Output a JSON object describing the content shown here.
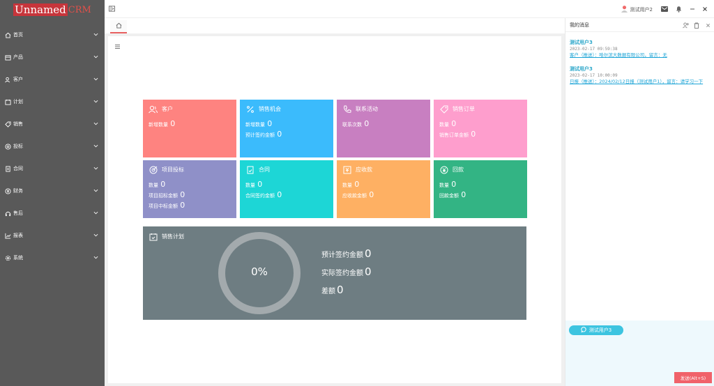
{
  "logo": {
    "part1": "Unnamed",
    "part2": "CRM"
  },
  "sidebar": {
    "items": [
      {
        "label": "首页",
        "icon": "home-icon"
      },
      {
        "label": "产品",
        "icon": "box-icon"
      },
      {
        "label": "客户",
        "icon": "users-icon"
      },
      {
        "label": "计划",
        "icon": "calendar-icon"
      },
      {
        "label": "销售",
        "icon": "tag-icon"
      },
      {
        "label": "投标",
        "icon": "target-icon"
      },
      {
        "label": "合同",
        "icon": "document-icon"
      },
      {
        "label": "财务",
        "icon": "yen-icon"
      },
      {
        "label": "售后",
        "icon": "headset-icon"
      },
      {
        "label": "报表",
        "icon": "chart-icon"
      },
      {
        "label": "系统",
        "icon": "gear-icon"
      }
    ]
  },
  "topbar": {
    "username": "测试用户2"
  },
  "cards": [
    {
      "title": "客户",
      "color": "#fe8380",
      "lines": [
        {
          "label": "新增数量",
          "value": "0"
        }
      ]
    },
    {
      "title": "销售机会",
      "color": "#3bbbfc",
      "lines": [
        {
          "label": "新增数量",
          "value": "0"
        },
        {
          "label": "预计签约金额",
          "value": "0"
        }
      ]
    },
    {
      "title": "联系活动",
      "color": "#c87fc1",
      "lines": [
        {
          "label": "联系次数",
          "value": "0"
        }
      ]
    },
    {
      "title": "销售订单",
      "color": "#fe9ecd",
      "lines": [
        {
          "label": "数量",
          "value": "0"
        },
        {
          "label": "销售订单金额",
          "value": "0"
        }
      ]
    },
    {
      "title": "项目投标",
      "color": "#8f90c8",
      "lines": [
        {
          "label": "数量",
          "value": "0"
        },
        {
          "label": "项目招标金额",
          "value": "0"
        },
        {
          "label": "项目中标金额",
          "value": "0"
        }
      ]
    },
    {
      "title": "合同",
      "color": "#1dd6d6",
      "lines": [
        {
          "label": "数量",
          "value": "0"
        },
        {
          "label": "合同签约金额",
          "value": "0"
        }
      ]
    },
    {
      "title": "应收款",
      "color": "#feb063",
      "lines": [
        {
          "label": "数量",
          "value": "0"
        },
        {
          "label": "应收款金额",
          "value": "0"
        }
      ]
    },
    {
      "title": "回款",
      "color": "#33b484",
      "lines": [
        {
          "label": "数量",
          "value": "0"
        },
        {
          "label": "回款金额",
          "value": "0"
        }
      ]
    }
  ],
  "plan": {
    "title": "销售计划",
    "percent": "0%",
    "percent_value": 0,
    "stats": [
      {
        "label": "预计签约金额",
        "value": "0"
      },
      {
        "label": "实际签约金额",
        "value": "0"
      },
      {
        "label": "差额",
        "value": "0"
      }
    ]
  },
  "messages": {
    "title": "我的消息",
    "items": [
      {
        "user": "测试用户3",
        "time": "2023-02-17 09:59:38",
        "text": "客户（推送）：哈尔滨大数据有限公司，留言：无"
      },
      {
        "user": "测试用户3",
        "time": "2023-02-17 10:00:09",
        "text": "日报（推送）：2024/02/12日报（测试用户1），留言：请学习一下"
      }
    ],
    "target": "测试用户3",
    "send_label": "发送(Alt+S)"
  }
}
